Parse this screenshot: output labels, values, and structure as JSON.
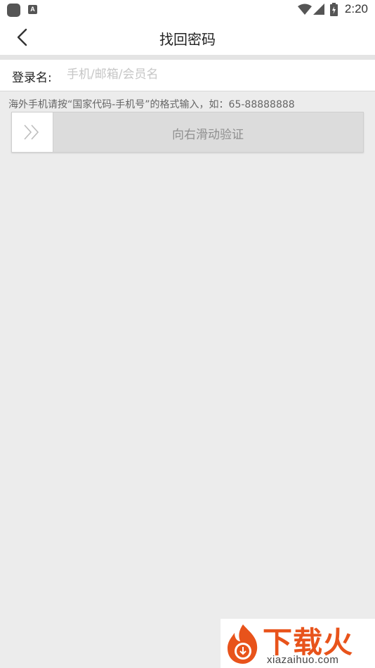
{
  "status_bar": {
    "time": "2:20",
    "app_icon_letter": "A",
    "icons": [
      "app-icon",
      "a-notification-icon",
      "wifi-icon",
      "signal-icon",
      "battery-charging-icon"
    ]
  },
  "header": {
    "title": "找回密码",
    "back_icon": "chevron-left-icon"
  },
  "form": {
    "login_label": "登录名:",
    "login_placeholder": "手机/邮箱/会员名",
    "login_value": ""
  },
  "hint": "海外手机请按“国家代码-手机号”的格式输入，如：65-88888888",
  "slider": {
    "label": "向右滑动验证",
    "handle_icon": "double-chevron-right-icon"
  },
  "watermark": {
    "brand": "下载火",
    "domain": "xiazaihuo.com",
    "color": "#e8531b"
  },
  "colors": {
    "background": "#ececec",
    "surface": "#ffffff",
    "slider_track": "#dcdcdc"
  }
}
